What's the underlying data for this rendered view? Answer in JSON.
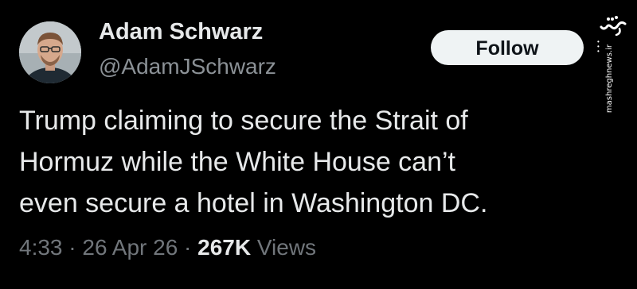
{
  "author": {
    "display_name": "Adam Schwarz",
    "handle": "@AdamJSchwarz"
  },
  "follow_button": {
    "label": "Follow"
  },
  "tweet": {
    "lines": [
      "Trump claiming to secure the Strait of",
      "Hormuz while the White House can’t",
      "even secure a hotel in Washington DC."
    ]
  },
  "meta": {
    "time": "4:33",
    "separator": "·",
    "date": "26 Apr 26",
    "views_count": "267K",
    "views_label": "Views"
  },
  "watermark": {
    "logo_text": "مشرق",
    "site": "mashreghnews.ir"
  },
  "colors": {
    "background": "#000000",
    "primary_text": "#e7e9ea",
    "secondary_text": "#71767b",
    "follow_bg": "#eff3f4"
  }
}
